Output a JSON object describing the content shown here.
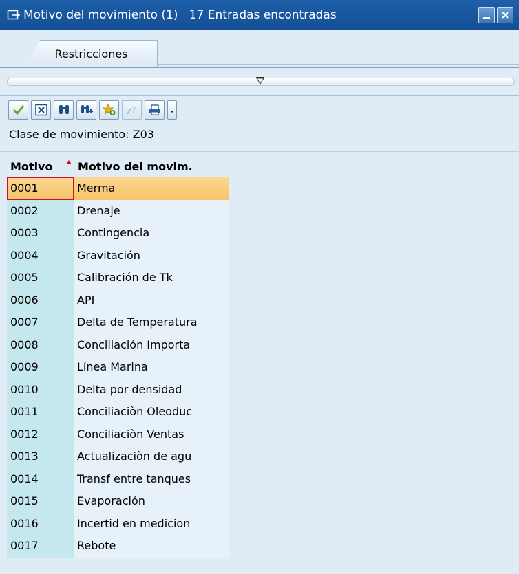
{
  "window": {
    "title": "Motivo del movimiento (1)   17 Entradas encontradas",
    "buttons": [
      "minimize-icon",
      "close-icon"
    ],
    "accent": "#1d5fa8"
  },
  "tabs": [
    {
      "label": "Restricciones"
    }
  ],
  "toolbar": {
    "icons": [
      "check-icon",
      "cancel-icon",
      "find-icon",
      "find-next-icon",
      "add-favorite-icon",
      "help-icon",
      "print-icon",
      "dropdown-arrow-icon"
    ]
  },
  "filter": {
    "text": "Clase de movimiento: Z03"
  },
  "table": {
    "columns": [
      "Motivo",
      "Motivo del movim."
    ],
    "selected_row": 0,
    "rows": [
      {
        "code": "0001",
        "desc": "Merma"
      },
      {
        "code": "0002",
        "desc": "Drenaje"
      },
      {
        "code": "0003",
        "desc": "Contingencia"
      },
      {
        "code": "0004",
        "desc": "Gravitación"
      },
      {
        "code": "0005",
        "desc": "Calibración de Tk"
      },
      {
        "code": "0006",
        "desc": "API"
      },
      {
        "code": "0007",
        "desc": "Delta de Temperatura"
      },
      {
        "code": "0008",
        "desc": "Conciliación Importa"
      },
      {
        "code": "0009",
        "desc": "Línea Marina"
      },
      {
        "code": "0010",
        "desc": "Delta por densidad"
      },
      {
        "code": "0011",
        "desc": "Conciliaciòn Oleoduc"
      },
      {
        "code": "0012",
        "desc": "Conciliaciòn Ventas"
      },
      {
        "code": "0013",
        "desc": "Actualizaciòn de agu"
      },
      {
        "code": "0014",
        "desc": "Transf entre tanques"
      },
      {
        "code": "0015",
        "desc": "Evaporación"
      },
      {
        "code": "0016",
        "desc": "Incertid en medicion"
      },
      {
        "code": "0017",
        "desc": "Rebote"
      }
    ]
  }
}
